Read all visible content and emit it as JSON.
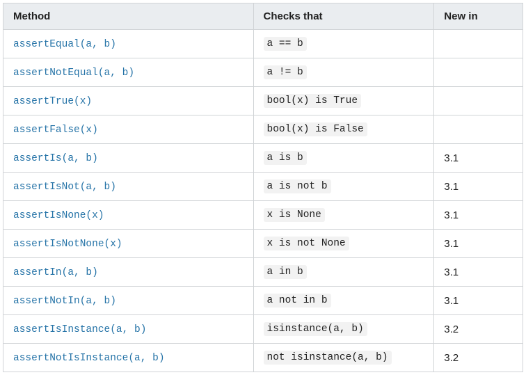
{
  "headers": {
    "method": "Method",
    "checks": "Checks that",
    "newin": "New in"
  },
  "rows": [
    {
      "method": "assertEqual(a, b)",
      "checks": "a == b",
      "newin": ""
    },
    {
      "method": "assertNotEqual(a, b)",
      "checks": "a != b",
      "newin": ""
    },
    {
      "method": "assertTrue(x)",
      "checks": "bool(x) is True",
      "newin": ""
    },
    {
      "method": "assertFalse(x)",
      "checks": "bool(x) is False",
      "newin": ""
    },
    {
      "method": "assertIs(a, b)",
      "checks": "a is b",
      "newin": "3.1"
    },
    {
      "method": "assertIsNot(a, b)",
      "checks": "a is not b",
      "newin": "3.1"
    },
    {
      "method": "assertIsNone(x)",
      "checks": "x is None",
      "newin": "3.1"
    },
    {
      "method": "assertIsNotNone(x)",
      "checks": "x is not None",
      "newin": "3.1"
    },
    {
      "method": "assertIn(a, b)",
      "checks": "a in b",
      "newin": "3.1"
    },
    {
      "method": "assertNotIn(a, b)",
      "checks": "a not in b",
      "newin": "3.1"
    },
    {
      "method": "assertIsInstance(a, b)",
      "checks": "isinstance(a, b)",
      "newin": "3.2"
    },
    {
      "method": "assertNotIsInstance(a, b)",
      "checks": "not isinstance(a, b)",
      "newin": "3.2"
    }
  ]
}
